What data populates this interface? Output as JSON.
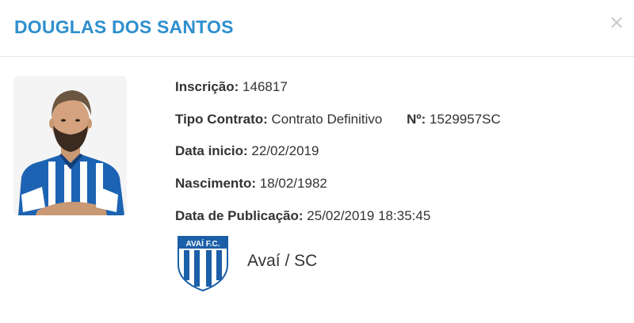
{
  "modal": {
    "title": "DOUGLAS DOS SANTOS",
    "close_icon": "close-icon"
  },
  "player": {
    "inscricao_label": "Inscrição:",
    "inscricao_value": "146817",
    "tipo_contrato_label": "Tipo Contrato:",
    "tipo_contrato_value": "Contrato Definitivo",
    "numero_label": "Nº:",
    "numero_value": "1529957SC",
    "data_inicio_label": "Data inicio:",
    "data_inicio_value": "22/02/2019",
    "nascimento_label": "Nascimento:",
    "nascimento_value": "18/02/1982",
    "publicacao_label": "Data de Publicação:",
    "publicacao_value": "25/02/2019 18:35:45"
  },
  "club": {
    "name": "Avaí / SC",
    "logo_text": "AVAÍ F.C."
  },
  "colors": {
    "title": "#2f8fce",
    "club_blue": "#1b5fa8",
    "text": "#333333"
  }
}
